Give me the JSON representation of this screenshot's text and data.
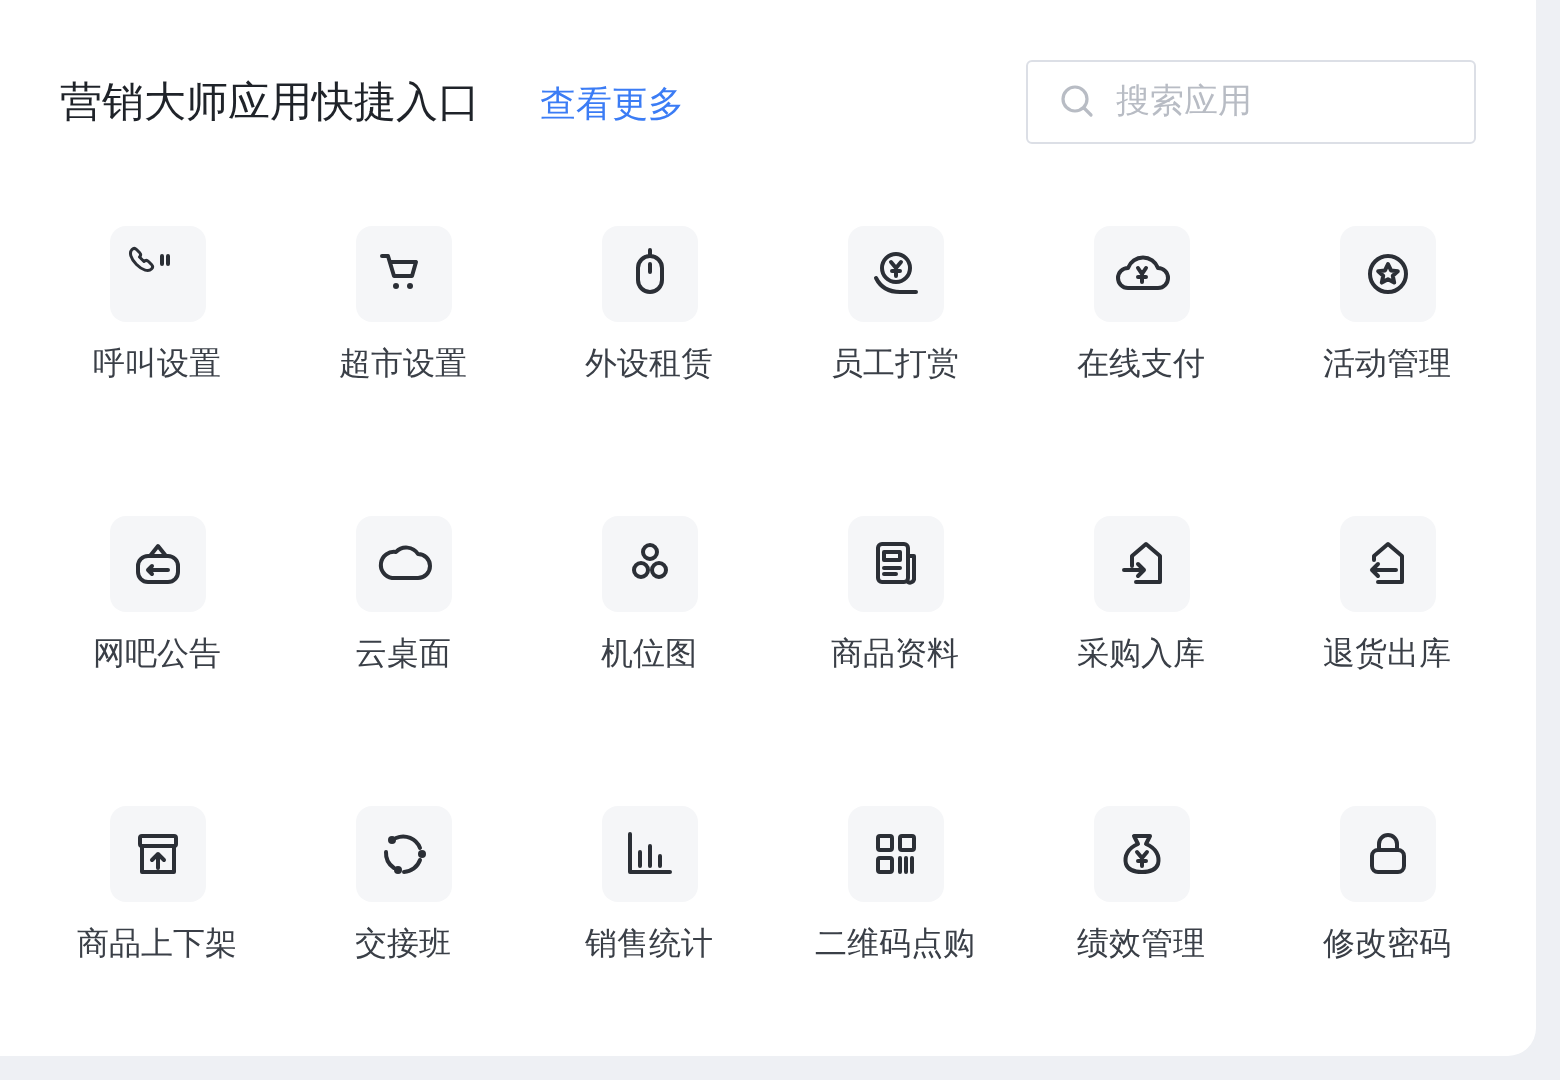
{
  "header": {
    "title": "营销大师应用快捷入口",
    "more_link": "查看更多",
    "search": {
      "placeholder": "搜索应用"
    }
  },
  "apps": [
    {
      "label": "呼叫设置"
    },
    {
      "label": "超市设置"
    },
    {
      "label": "外设租赁"
    },
    {
      "label": "员工打赏"
    },
    {
      "label": "在线支付"
    },
    {
      "label": "活动管理"
    },
    {
      "label": "网吧公告"
    },
    {
      "label": "云桌面"
    },
    {
      "label": "机位图"
    },
    {
      "label": "商品资料"
    },
    {
      "label": "采购入库"
    },
    {
      "label": "退货出库"
    },
    {
      "label": "商品上下架"
    },
    {
      "label": "交接班"
    },
    {
      "label": "销售统计"
    },
    {
      "label": "二维码点购"
    },
    {
      "label": "绩效管理"
    },
    {
      "label": "修改密码"
    }
  ]
}
